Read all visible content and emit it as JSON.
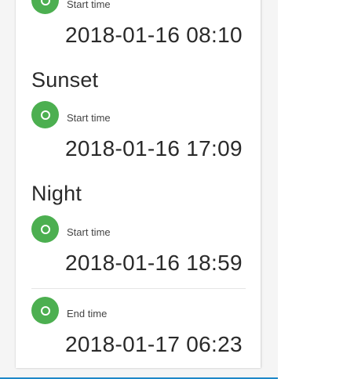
{
  "colors": {
    "accent_green": "#4caf50",
    "bottom_bar_blue": "#1e88c8"
  },
  "entries": [
    {
      "label": "Start time",
      "value": "2018-01-16 08:10",
      "icon": "circle-icon"
    },
    {
      "label": "Start time",
      "value": "2018-01-16 17:09",
      "icon": "circle-icon"
    },
    {
      "label": "Start time",
      "value": "2018-01-16 18:59",
      "icon": "circle-icon"
    },
    {
      "label": "End time",
      "value": "2018-01-17 06:23",
      "icon": "circle-icon"
    }
  ],
  "sections": {
    "sunset": {
      "title": "Sunset"
    },
    "night": {
      "title": "Night"
    }
  }
}
